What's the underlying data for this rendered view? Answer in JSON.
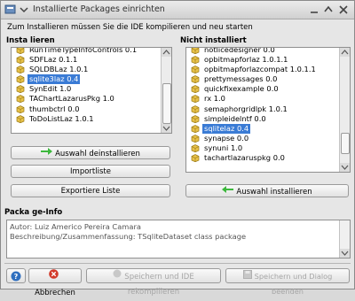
{
  "window": {
    "title": "Installierte Packages einrichten",
    "subtitle": "Zum Installieren müssen Sie die IDE kompilieren und neu starten"
  },
  "installed": {
    "label": "Insta lieren",
    "items": [
      {
        "text": "RunTimeTypeInfoControls 0.1",
        "selected": false
      },
      {
        "text": "SDFLaz 0.1.1",
        "selected": false
      },
      {
        "text": "SQLDBLaz 1.0.1",
        "selected": false
      },
      {
        "text": "sqlite3laz 0.4",
        "selected": true
      },
      {
        "text": "SynEdit 1.0",
        "selected": false
      },
      {
        "text": "TAChartLazarusPkg 1.0",
        "selected": false
      },
      {
        "text": "thumbctrl 0.0",
        "selected": false
      },
      {
        "text": "ToDoListLaz 1.0.1",
        "selected": false
      }
    ],
    "buttons": {
      "uninstall": "Auswahl deinstallieren",
      "import": "Importliste",
      "export": "Exportiere Liste"
    }
  },
  "not_installed": {
    "label": "Nicht installiert",
    "items": [
      {
        "text": "notlicedesigner 0.0",
        "selected": false
      },
      {
        "text": "opbitmapforlaz 1.0.1.1",
        "selected": false
      },
      {
        "text": "opbitmapforlazcompat 1.0.1.1",
        "selected": false
      },
      {
        "text": "prettymessages 0.0",
        "selected": false
      },
      {
        "text": "quickfixexample 0.0",
        "selected": false
      },
      {
        "text": "rx 1.0",
        "selected": false
      },
      {
        "text": "semaphorgridlpk 1.0.1",
        "selected": false
      },
      {
        "text": "simpleidelntf 0.0",
        "selected": false
      },
      {
        "text": "sqlitelaz 0.4",
        "selected": true
      },
      {
        "text": "synapse 0.0",
        "selected": false
      },
      {
        "text": "synuni 1.0",
        "selected": false
      },
      {
        "text": "tachartlazaruspkg 0.0",
        "selected": false
      }
    ],
    "buttons": {
      "install": "Auswahl installieren"
    }
  },
  "package_info": {
    "label": "Packa ge-Info",
    "lines": [
      "Autor: Luiz Americo Pereira Camara",
      "Beschreibung/Zusammenfassung: TSqliteDataset class package"
    ]
  },
  "footer": {
    "help": "?",
    "cancel": "Abbrechen",
    "save_rebuild": "Speichern und IDE rekompilieren",
    "save_close": "Speichern und Dialog beenden"
  },
  "colors": {
    "selection": "#3a7bd5",
    "green_arrow": "#3db83d",
    "cancel_red": "#d23a2a",
    "help_blue": "#2f6fbf"
  }
}
